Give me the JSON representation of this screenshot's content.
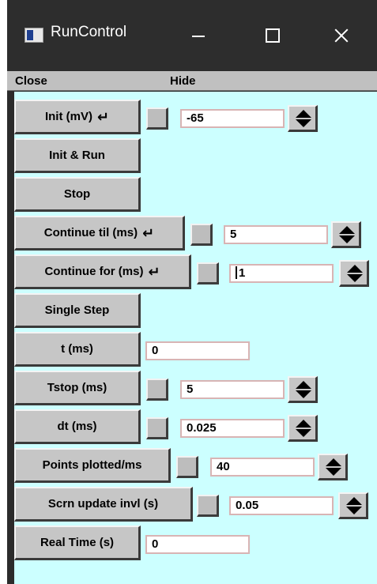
{
  "window": {
    "title": "RunControl",
    "icon": "window-icon",
    "controls": [
      "minimize-icon",
      "maximize-icon",
      "close-icon"
    ]
  },
  "menu": {
    "close": "Close",
    "hide": "Hide"
  },
  "colors": {
    "panel_bg": "#ccffff",
    "button_face": "#c6c6c6",
    "field_border": "#d8b4b4",
    "titlebar": "#2d2d2d"
  },
  "controls": {
    "init": {
      "label": "Init (mV)",
      "value": "-65"
    },
    "init_run": {
      "label": "Init & Run"
    },
    "stop": {
      "label": "Stop"
    },
    "continue_til": {
      "label": "Continue til (ms)",
      "value": "5"
    },
    "continue_for": {
      "label": "Continue for (ms)",
      "value": "1"
    },
    "single_step": {
      "label": "Single Step"
    },
    "t": {
      "label": "t (ms)",
      "value": "0"
    },
    "tstop": {
      "label": "Tstop (ms)",
      "value": "5"
    },
    "dt": {
      "label": "dt (ms)",
      "value": "0.025"
    },
    "points_plotted": {
      "label": "Points plotted/ms",
      "value": "40"
    },
    "scrn_update": {
      "label": "Scrn update invl (s)",
      "value": "0.05"
    },
    "real_time": {
      "label": "Real Time (s)",
      "value": "0"
    }
  }
}
